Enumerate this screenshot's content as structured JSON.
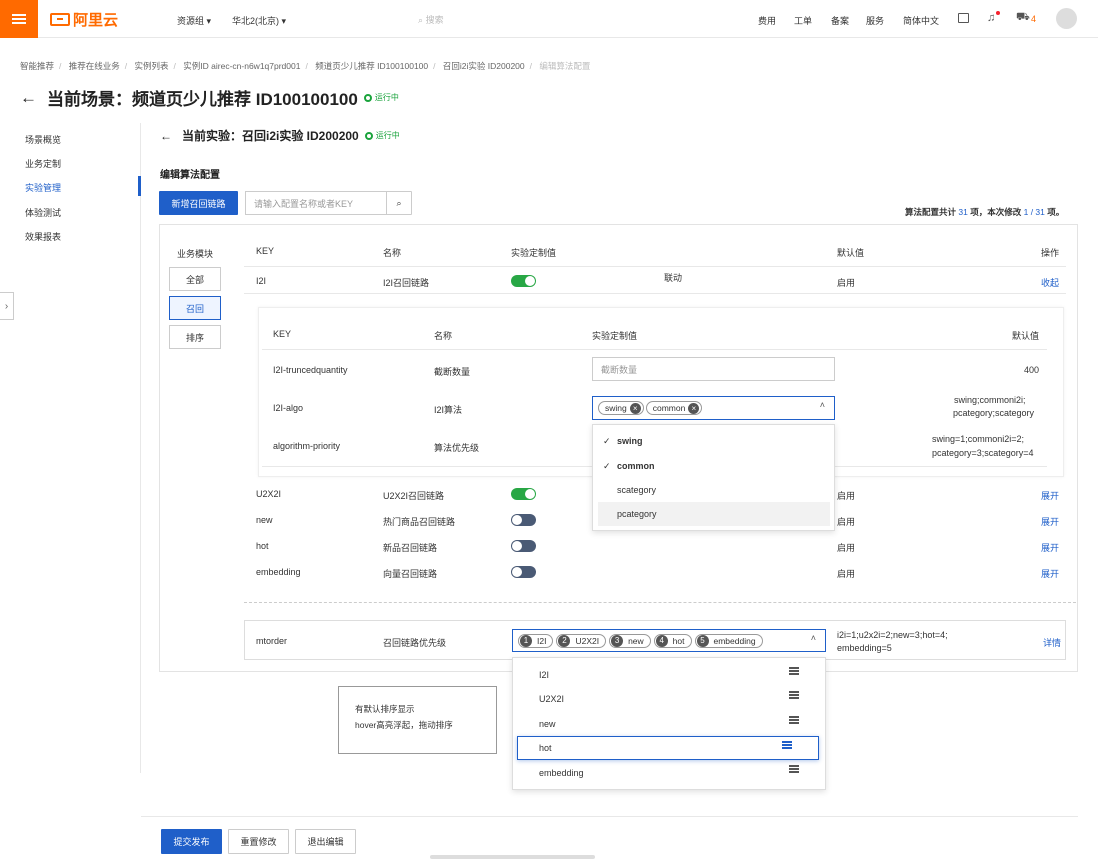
{
  "topbar": {
    "logo": "阿里云",
    "resource_group": "资源组 ▾",
    "region": "华北2(北京) ▾",
    "search_placeholder": "搜索",
    "links": [
      "费用",
      "工单",
      "备案",
      "服务",
      "简体中文"
    ],
    "cart_count": "4"
  },
  "breadcrumb": [
    "智能推荐",
    "推荐在线业务",
    "实例列表",
    "实例ID airec-cn-n6w1q7prd001",
    "频道页少儿推荐 ID100100100",
    "召回i2i实验 ID200200",
    "编辑算法配置"
  ],
  "page": {
    "title": "当前场景：频道页少儿推荐 ID100100100",
    "status": "运行中"
  },
  "sidenav": [
    "场景概览",
    "业务定制",
    "实验管理",
    "体验测试",
    "效果报表"
  ],
  "experiment": {
    "title": "当前实验：召回i2i实验 ID200200",
    "status": "运行中"
  },
  "section_title": "编辑算法配置",
  "toolbar": {
    "add_button": "新增召回链路",
    "search_placeholder": "请输入配置名称或者KEY",
    "summary_prefix": "算法配置共计",
    "summary_total": "31",
    "summary_mid": "项，本次修改",
    "summary_changed": "1 / 31",
    "summary_suffix": "项。"
  },
  "categories": {
    "label": "业务模块",
    "items": [
      "全部",
      "召回",
      "排序"
    ],
    "active": "召回"
  },
  "table": {
    "headers": [
      "KEY",
      "名称",
      "实验定制值",
      "默认值",
      "操作"
    ],
    "rows": [
      {
        "key": "I2I",
        "name": "I2I召回链路",
        "toggle": true,
        "linked": "联动",
        "default": "启用",
        "action": "收起"
      },
      {
        "key": "U2X2I",
        "name": "U2X2I召回链路",
        "toggle": true,
        "default": "启用",
        "action": "展开"
      },
      {
        "key": "new",
        "name": "热门商品召回链路",
        "toggle": false,
        "default": "启用",
        "action": "展开"
      },
      {
        "key": "hot",
        "name": "新品召回链路",
        "toggle": false,
        "default": "启用",
        "action": "展开"
      },
      {
        "key": "embedding",
        "name": "向量召回链路",
        "toggle": false,
        "default": "启用",
        "action": "展开"
      }
    ]
  },
  "inner_table": {
    "headers": [
      "KEY",
      "名称",
      "实验定制值",
      "默认值"
    ],
    "rows": [
      {
        "key": "I2I-truncedquantity",
        "name": "截断数量",
        "placeholder": "截断数量",
        "default": "400"
      },
      {
        "key": "I2I-algo",
        "name": "I2I算法",
        "tags": [
          "swing",
          "common"
        ],
        "default_l1": "swing;commoni2i;",
        "default_l2": "pcategory;scategory"
      },
      {
        "key": "algorithm-priority",
        "name": "算法优先级",
        "default_l1": "swing=1;commoni2i=2;",
        "default_l2": "pcategory=3;scategory=4"
      }
    ],
    "algo_options": [
      {
        "label": "swing",
        "checked": true
      },
      {
        "label": "common",
        "checked": true
      },
      {
        "label": "scategory",
        "checked": false
      },
      {
        "label": "pcategory",
        "checked": false
      }
    ]
  },
  "mtorder": {
    "key": "mtorder",
    "name": "召回链路优先级",
    "tags": [
      {
        "n": "1",
        "label": "I2I"
      },
      {
        "n": "2",
        "label": "U2X2I"
      },
      {
        "n": "3",
        "label": "new"
      },
      {
        "n": "4",
        "label": "hot"
      },
      {
        "n": "5",
        "label": "embedding"
      }
    ],
    "default_l1": "i2i=1;u2x2i=2;new=3;hot=4;",
    "default_l2": "embedding=5",
    "action": "详情",
    "sort_options": [
      "I2I",
      "U2X2I",
      "new",
      "hot",
      "embedding"
    ],
    "hovered": "hot"
  },
  "note": {
    "line1": "有默认排序显示",
    "line2": "hover高亮浮起，拖动排序"
  },
  "footer": {
    "submit": "提交发布",
    "reset": "重置修改",
    "exit": "退出编辑"
  },
  "colors": {
    "brand": "#ff6a00",
    "primary": "#1f5fc9",
    "success": "#28a745",
    "toggle_off": "#4a5a75"
  }
}
